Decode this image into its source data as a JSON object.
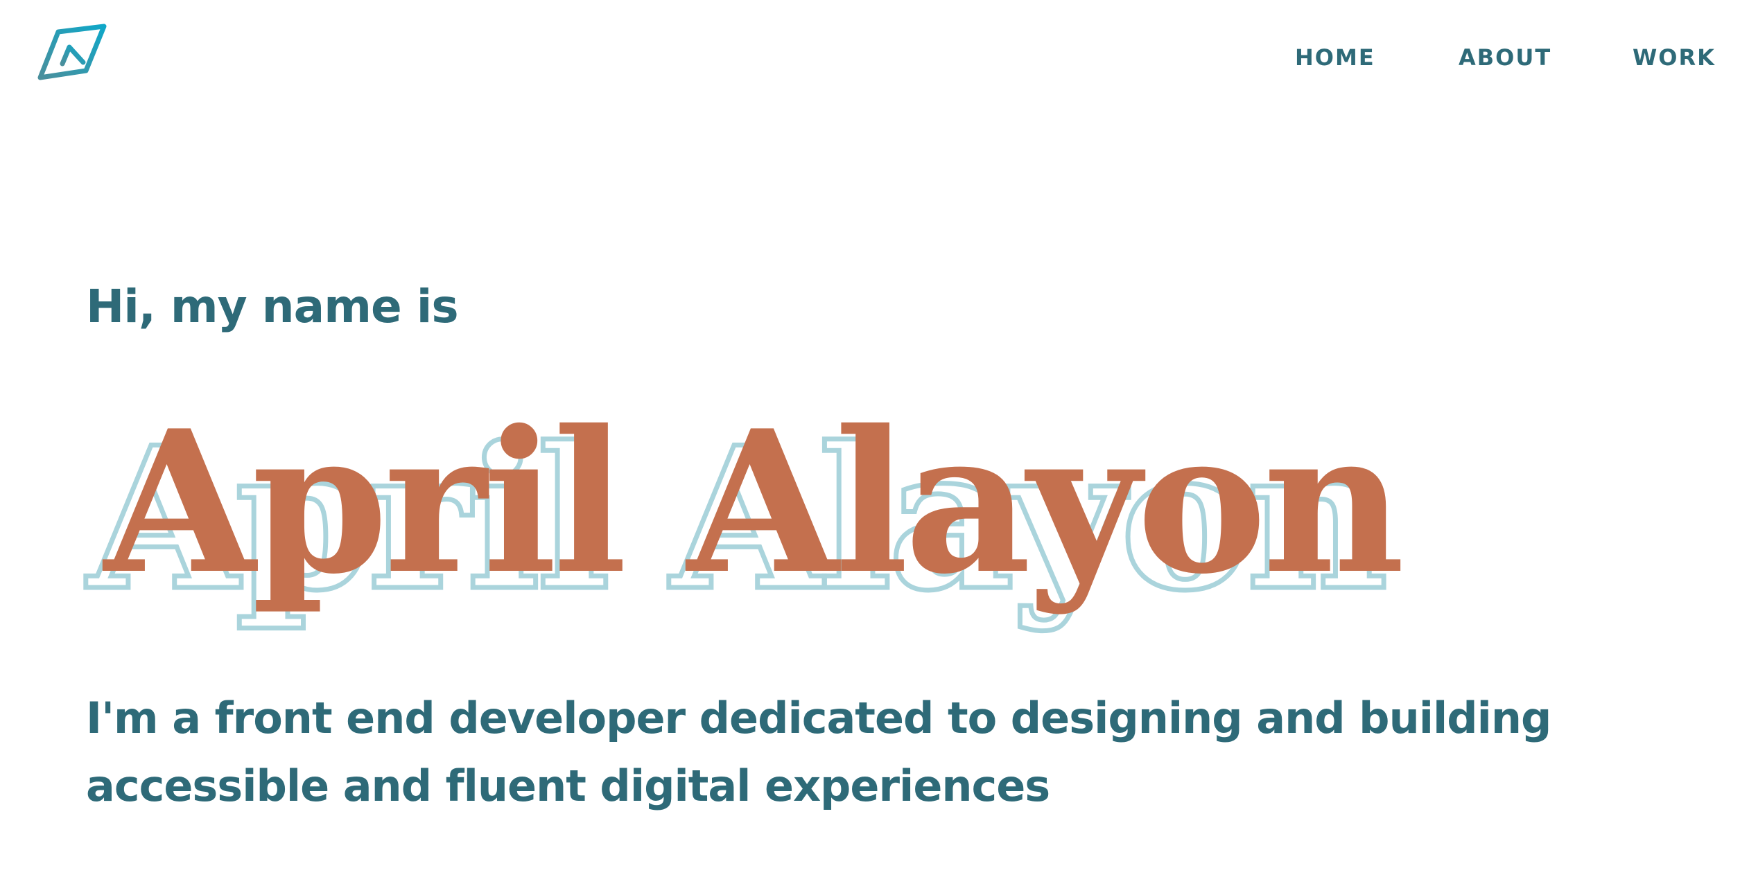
{
  "nav": {
    "items": [
      {
        "label": "HOME"
      },
      {
        "label": "ABOUT"
      },
      {
        "label": "WORK"
      }
    ]
  },
  "hero": {
    "greeting": "Hi, my name is",
    "name": "April Alayon",
    "tagline_line1": "I'm a front end developer dedicated to designing and building",
    "tagline_line2": "accessible and fluent digital experiences"
  },
  "colors": {
    "primary_text": "#2e6a78",
    "name_fill": "#c4704e",
    "name_shadow": "#aad4dc",
    "logo_gradient_start": "#0fa7c8",
    "logo_gradient_end": "#4a8f9c"
  },
  "logo": {
    "icon": "diamond-logo-icon"
  }
}
